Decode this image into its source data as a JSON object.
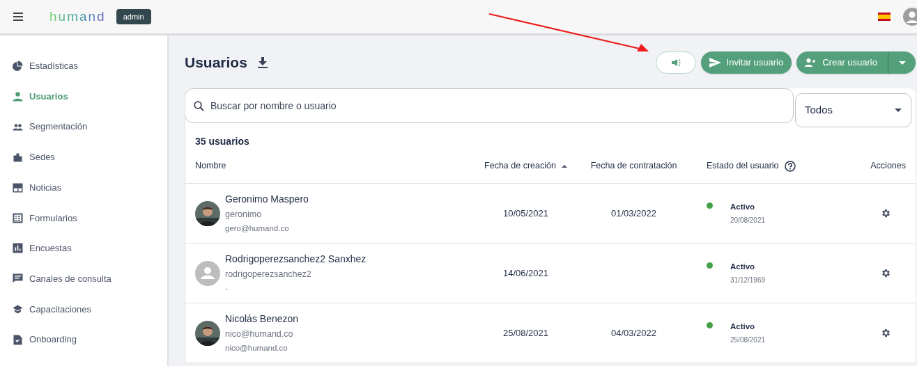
{
  "header": {
    "logo": "humand",
    "role_badge": "admin"
  },
  "sidebar": {
    "items": [
      {
        "label": "Estadísticas",
        "selected": false
      },
      {
        "label": "Usuarios",
        "selected": true
      },
      {
        "label": "Segmentación",
        "selected": false
      },
      {
        "label": "Sedes",
        "selected": false
      },
      {
        "label": "Noticias",
        "selected": false
      },
      {
        "label": "Formularios",
        "selected": false
      },
      {
        "label": "Encuestas",
        "selected": false
      },
      {
        "label": "Canales de consulta",
        "selected": false
      },
      {
        "label": "Capacitaciones",
        "selected": false
      },
      {
        "label": "Onboarding",
        "selected": false
      }
    ]
  },
  "page": {
    "title": "Usuarios",
    "buttons": [
      "Invitar usuario",
      "Crear usuario"
    ]
  },
  "search": {
    "placeholder": "Buscar por nombre o usuario"
  },
  "filter": {
    "value": "Todos"
  },
  "table": {
    "count": "35 usuarios",
    "columns": [
      "Nombre",
      "Fecha de creación",
      "Fecha de contratación",
      "Estado del usuario",
      "Acciones"
    ],
    "rows": [
      {
        "name": "Geronimo Maspero",
        "username": "geronimo",
        "email": "gero@humand.co",
        "created": "10/05/2021",
        "hired": "01/03/2022",
        "status": "Activo",
        "status_date": "20/08/2021",
        "color": "#43a047"
      },
      {
        "kind": "placeholder",
        "name": "Rodrigoperezsanchez2 Sanxhez",
        "username": "rodrigoperezsanchez2",
        "email": "-",
        "created": "14/06/2021",
        "status": "Activo",
        "status_date": "31/12/1969",
        "color": "#43a047"
      },
      {
        "name": "Nicolás Benezon",
        "username": "nico@humand.co",
        "email": "nico@humand.co",
        "created": "25/08/2021",
        "hired": "04/03/2022",
        "status": "Activo",
        "status_date": "25/08/2021",
        "color": "#43a047"
      }
    ]
  }
}
